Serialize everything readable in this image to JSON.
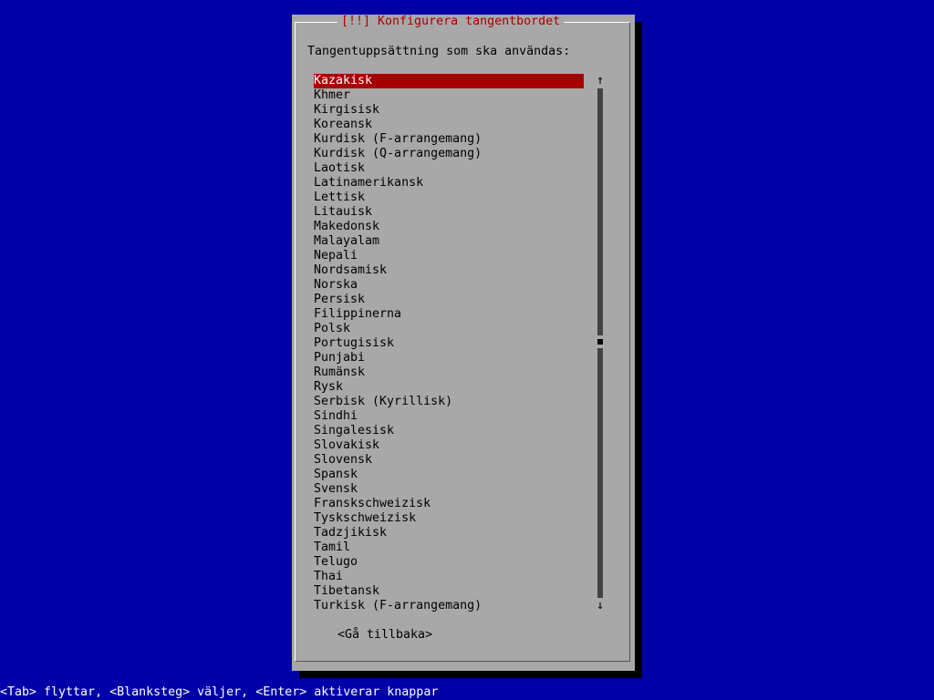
{
  "dialog": {
    "title": "[!!] Konfigurera tangentbordet",
    "prompt": "Tangentuppsättning som ska användas:",
    "back_button": "<Gå tillbaka>"
  },
  "layouts": [
    "Kazakisk",
    "Khmer",
    "Kirgisisk",
    "Koreansk",
    "Kurdisk (F-arrangemang)",
    "Kurdisk (Q-arrangemang)",
    "Laotisk",
    "Latinamerikansk",
    "Lettisk",
    "Litauisk",
    "Makedonsk",
    "Malayalam",
    "Nepali",
    "Nordsamisk",
    "Norska",
    "Persisk",
    "Filippinerna",
    "Polsk",
    "Portugisisk",
    "Punjabi",
    "Rumänsk",
    "Rysk",
    "Serbisk (Kyrillisk)",
    "Sindhi",
    "Singalesisk",
    "Slovakisk",
    "Slovensk",
    "Spansk",
    "Svensk",
    "Franskschweizisk",
    "Tyskschweizisk",
    "Tadzjikisk",
    "Tamil",
    "Telugo",
    "Thai",
    "Tibetansk",
    "Turkisk (F-arrangemang)"
  ],
  "selected_layout": "Kazakisk",
  "scrollbar": {
    "up_arrow": "↑",
    "down_arrow": "↓",
    "position_fraction": 0.5
  },
  "status_bar": "<Tab> flyttar, <Blanksteg> väljer, <Enter> aktiverar knappar",
  "colors": {
    "background": "#0000a8",
    "dialog": "#a8a8a8",
    "title_text": "#a80000",
    "selection": "#a80000"
  }
}
